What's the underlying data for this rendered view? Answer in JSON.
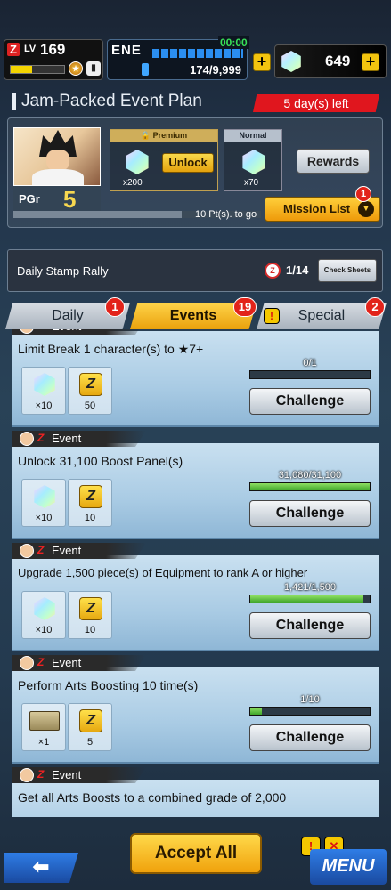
{
  "player": {
    "level_label": "LV",
    "level": "169",
    "level_progress": 0.4,
    "energy_label": "ENE",
    "energy_timer": "00:00",
    "energy_value": "174/9,999",
    "gems": "649"
  },
  "plan": {
    "title": "Jam-Packed Event Plan",
    "days_left": "5 day(s) left",
    "pgr_label": "PGr",
    "pgr_value": "5",
    "progress": 0.68,
    "points_to_go": "10 Pt(s). to go",
    "premium_label": "Premium",
    "premium_qty": "x200",
    "unlock_label": "Unlock",
    "normal_label": "Normal",
    "normal_qty": "x70",
    "rewards_label": "Rewards",
    "mission_list_label": "Mission List",
    "mission_badge": "1"
  },
  "stamp_rally": {
    "label": "Daily Stamp Rally",
    "count": "1/14",
    "check_label": "Check Sheets"
  },
  "tabs": [
    {
      "label": "Daily",
      "badge": "1"
    },
    {
      "label": "Events",
      "badge": "19"
    },
    {
      "label": "Special",
      "badge": "2"
    }
  ],
  "event_label": "Event",
  "challenge_label": "Challenge",
  "missions": [
    {
      "title": "Limit Break 1 character(s) to ★7+",
      "rewards": [
        {
          "icon": "chrono-crystal-icon",
          "qty": "×10"
        },
        {
          "icon": "zeni-icon",
          "qty": "50"
        }
      ],
      "goal": "0/1",
      "progress": 0
    },
    {
      "title": "Unlock 31,100 Boost Panel(s)",
      "rewards": [
        {
          "icon": "chrono-crystal-icon",
          "qty": "×10"
        },
        {
          "icon": "zeni-icon",
          "qty": "10"
        }
      ],
      "goal": "31,080/31,100",
      "progress": 0.999
    },
    {
      "title": "Upgrade 1,500 piece(s) of Equipment to rank A or higher",
      "rewards": [
        {
          "icon": "chrono-crystal-icon",
          "qty": "×10"
        },
        {
          "icon": "zeni-icon",
          "qty": "10"
        }
      ],
      "goal": "1,421/1,500",
      "progress": 0.947
    },
    {
      "title": "Perform Arts Boosting 10 time(s)",
      "rewards": [
        {
          "icon": "ticket-icon",
          "qty": "×1"
        },
        {
          "icon": "zeni-icon",
          "qty": "5"
        }
      ],
      "goal": "1/10",
      "progress": 0.1
    },
    {
      "title": "Get all Arts Boosts to a combined grade of 2,000",
      "rewards": [],
      "goal": "",
      "progress": 0
    }
  ],
  "bottom": {
    "accept_all_label": "Accept All",
    "menu_label": "MENU"
  }
}
